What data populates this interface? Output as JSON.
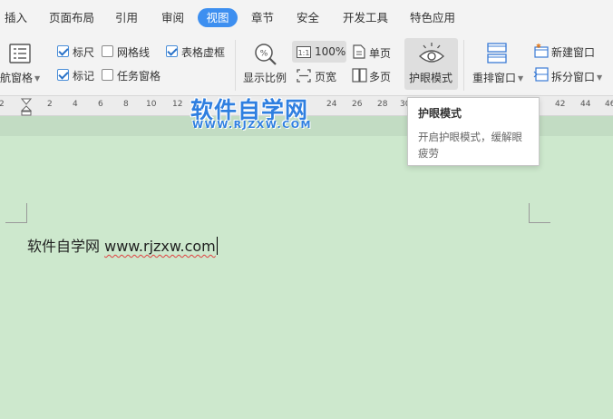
{
  "menu": {
    "tabs": [
      {
        "label": "插入"
      },
      {
        "label": "页面布局"
      },
      {
        "label": "引用"
      },
      {
        "label": "审阅"
      },
      {
        "label": "视图"
      },
      {
        "label": "章节"
      },
      {
        "label": "安全"
      },
      {
        "label": "开发工具"
      },
      {
        "label": "特色应用"
      }
    ]
  },
  "ribbon": {
    "nav_pane_label": "导航窗格",
    "ruler_label": "标尺",
    "gridlines_label": "网格线",
    "table_gridlines_label": "表格虚框",
    "marks_label": "标记",
    "task_pane_label": "任务窗格",
    "zoom_label": "显示比例",
    "zoom_value": "100%",
    "page_width_label": "页宽",
    "single_page_label": "单页",
    "multi_page_label": "多页",
    "eye_mode_label": "护眼模式",
    "arrange_label": "重排窗口",
    "new_window_label": "新建窗口",
    "split_label": "拆分窗口",
    "checks": {
      "ruler": true,
      "gridlines": false,
      "table_gridlines": true,
      "marks": true,
      "task_pane": false
    }
  },
  "ruler": {
    "left_numbers": [
      "2",
      "2",
      "4",
      "6",
      "8",
      "10",
      "12"
    ],
    "mid_numbers": [
      "24",
      "26",
      "28",
      "30"
    ],
    "right_numbers": [
      "42",
      "44",
      "46"
    ]
  },
  "watermark": {
    "title": "软件自学网",
    "url": "WWW.RJZXW.COM"
  },
  "document": {
    "text": "软件自学网",
    "url": "www.rjzxw.com"
  },
  "tooltip": {
    "title": "护眼模式",
    "description": "开启护眼模式，缓解眼疲劳"
  },
  "colors": {
    "accent": "#3d8ff0",
    "eye_mode_bg": "#cde8cd",
    "watermark": "#2f7fe0"
  }
}
